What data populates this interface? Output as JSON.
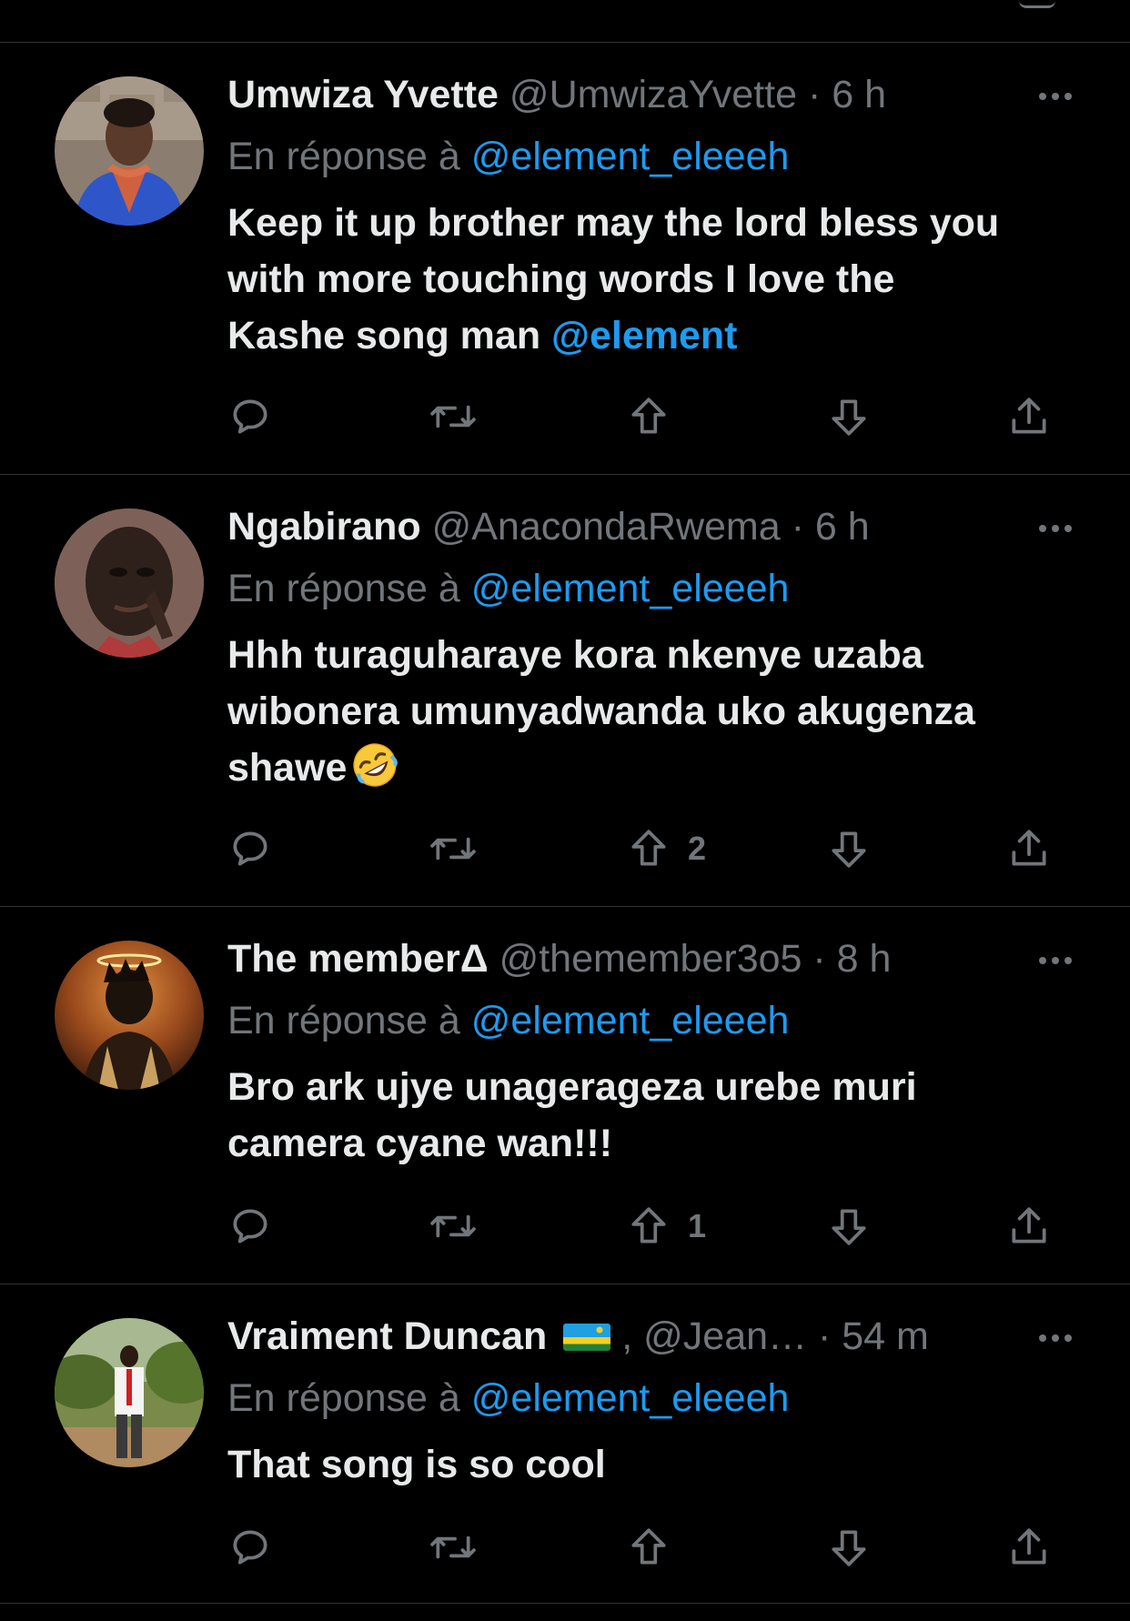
{
  "reply_prefix": "En réponse à",
  "tweets": [
    {
      "display_name": "Umwiza Yvette",
      "handle": "@UmwizaYvette",
      "time": "6 h",
      "reply_to": "@element_eleeeh",
      "text_line1": "Keep it up brother may the lord bless you",
      "text_line2": "with more touching words I love the",
      "text_line3": "Kashe song man ",
      "text_mention": "@element",
      "upvotes": ""
    },
    {
      "display_name": "Ngabirano",
      "handle": "@AnacondaRwema",
      "time": "6 h",
      "reply_to": "@element_eleeeh",
      "text_line1": "Hhh turaguharaye kora nkenye uzaba",
      "text_line2": "wibonera umunyadwanda uko akugenza",
      "text_line3": "shawe",
      "emoji": "rolling-on-floor-laughing",
      "upvotes": "2"
    },
    {
      "display_name": "The memberΔ",
      "handle": "@themember3o5",
      "time": "8 h",
      "reply_to": "@element_eleeeh",
      "text_line1": "Bro ark ujye unagerageza urebe muri",
      "text_line2": "camera cyane wan!!!",
      "upvotes": "1"
    },
    {
      "display_name": "Vraiment Duncan",
      "name_suffix": ",",
      "handle": "@Jean…",
      "time": "54 m",
      "reply_to": "@element_eleeeh",
      "flag": "rwanda-flag",
      "text_line1": "That song is so cool",
      "upvotes": ""
    }
  ],
  "separator": "·",
  "icons": {
    "reply": "speech-bubble-icon",
    "retweet": "retweet-icon",
    "upvote": "arrow-up-icon",
    "downvote": "arrow-down-icon",
    "share": "share-icon",
    "more": "more-dots-icon"
  },
  "colors": {
    "background": "#000000",
    "text": "#e7e9ea",
    "secondary": "#71767b",
    "link": "#1d9bf0",
    "divider": "#2f3336"
  }
}
